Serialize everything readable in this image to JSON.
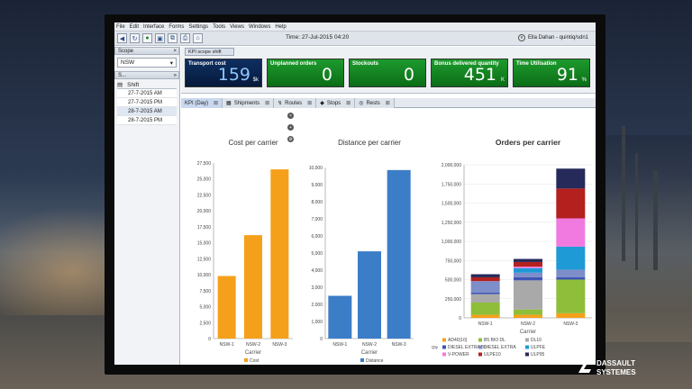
{
  "menu": [
    "File",
    "Edit",
    "Interface",
    "Forms",
    "Settings",
    "Tools",
    "Views",
    "Windows",
    "Help"
  ],
  "toolbar": {
    "time": "Time: 27-Jul-2015 04:20",
    "user": "Ella Dahan - quintiq/sdn1"
  },
  "scope": {
    "title": "Scope",
    "value": "NSW"
  },
  "shifts": {
    "panel": "S...",
    "header": "Shift",
    "rows": [
      "27-7-2015 AM",
      "27-7-2015 PM",
      "28-7-2015 AM",
      "28-7-2015 PM"
    ]
  },
  "kpi_tab": "KPI scope shift",
  "kpis": [
    {
      "label": "Transport cost",
      "value": "159",
      "unit": "$k",
      "color": "blue"
    },
    {
      "label": "Unplanned orders",
      "value": "0",
      "unit": "",
      "color": "green"
    },
    {
      "label": "Stockouts",
      "value": "0",
      "unit": "",
      "color": "green"
    },
    {
      "label": "Bonus delivered quantity",
      "value": "451",
      "unit": "K",
      "color": "green"
    },
    {
      "label": "Time Utilisation",
      "value": "91",
      "unit": "%",
      "color": "green"
    }
  ],
  "tabs": [
    "KPI (Day)",
    "Shipments",
    "Routes",
    "Stops",
    "Rests"
  ],
  "chart_data": [
    {
      "type": "bar",
      "title": "Cost per carrier",
      "xlabel": "Carrier",
      "categories": [
        "NSW-1",
        "NSW-2",
        "NSW-3"
      ],
      "series": [
        {
          "name": "Cost",
          "values": [
            9800,
            16200,
            26500
          ],
          "color": "#f5a01a"
        }
      ],
      "ylim": [
        0,
        27500
      ],
      "ticks": [
        "0",
        "2,500",
        "5,000",
        "7,500",
        "10,000",
        "12,500",
        "15,000",
        "17,500",
        "20,000",
        "22,500",
        "25,000",
        "27,500"
      ]
    },
    {
      "type": "bar",
      "title": "Distance per carrier",
      "xlabel": "Carrier",
      "categories": [
        "NSW-1",
        "NSW-2",
        "NSW-3"
      ],
      "series": [
        {
          "name": "Distance",
          "values": [
            2500,
            5100,
            9850
          ],
          "color": "#3c7dc8"
        }
      ],
      "ylim": [
        0,
        10000
      ],
      "ticks": [
        "0",
        "1,000",
        "2,000",
        "3,000",
        "4,000",
        "5,000",
        "6,000",
        "7,000",
        "8,000",
        "9,000",
        "10,000"
      ]
    },
    {
      "type": "bar",
      "title": "Orders per carrier",
      "xlabel": "Carrier",
      "categories": [
        "NSW-1",
        "NSW-2",
        "NSW-3"
      ],
      "ylim": [
        0,
        2000000
      ],
      "ticks": [
        "0",
        "250,000",
        "500,000",
        "750,000",
        "1,000,000",
        "1,250,000",
        "1,500,000",
        "1,750,000",
        "2,000,000"
      ],
      "legend_prefix": "Qty",
      "series": [
        {
          "name": "AD40(10)",
          "color": "#f5a01a",
          "values": [
            40000,
            40000,
            60000
          ]
        },
        {
          "name": "B5 BIO DL",
          "color": "#8fbe3a",
          "values": [
            160000,
            70000,
            440000
          ]
        },
        {
          "name": "DL10",
          "color": "#a9a9a9",
          "values": [
            110000,
            380000,
            0
          ]
        },
        {
          "name": "DIESEL EXTRA B5",
          "color": "#3f55b5",
          "values": [
            20000,
            40000,
            30000
          ]
        },
        {
          "name": "DIESEL EXTRA",
          "color": "#7d8ec9",
          "values": [
            150000,
            60000,
            100000
          ]
        },
        {
          "name": "ULPFE",
          "color": "#1e9ad6",
          "values": [
            0,
            60000,
            300000
          ]
        },
        {
          "name": "V-POWER",
          "color": "#f07ae0",
          "values": [
            0,
            20000,
            370000
          ]
        },
        {
          "name": "ULPE10",
          "color": "#b3201e",
          "values": [
            50000,
            60000,
            390000
          ]
        },
        {
          "name": "ULP95",
          "color": "#252a5a",
          "values": [
            40000,
            40000,
            260000
          ]
        }
      ]
    }
  ],
  "logo": "DASSAULT SYSTEMES"
}
